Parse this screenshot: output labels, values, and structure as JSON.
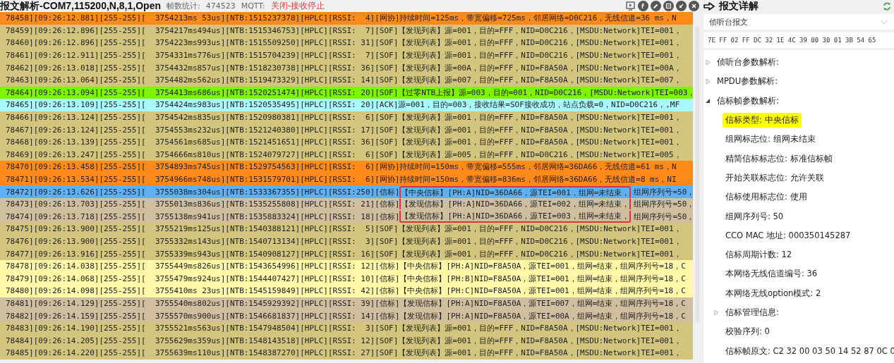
{
  "header": {
    "title": "报文解析-COM7,115200,N,8,1,Open",
    "frame_count_label": "帧数统计:",
    "frame_count": "474523",
    "mqtt_label": "MQTT:",
    "mqtt_status": "关闭-接收停止"
  },
  "log_rows": [
    {
      "color": "#ff8a1c",
      "text": "78458][09:26:12.881][255-255][  3754213ms 53us][NTB:1515237378][HPLC][RSSI:  4][网协]持续时间=125ms，带宽偏移=725ms，邻居网络=D0C216，无线信道=36 ms，N"
    },
    {
      "color": "#d2c67e",
      "text": "78459][09:26:12.896][255-255][  3754217ms494us][NTB:1515346753][HPLC][RSSI:  7][SOF]【发现列表】源=001，目的=FFF，NID=D0C216，[MSDU:Network]TEI=001，"
    },
    {
      "color": "#d2c67e",
      "text": "78460][09:26:12.896][255-255][  3754223ms993us][NTB:1515509250][HPLC][RSSI: 31][SOF]【发现列表】源=001，目的=FFF，NID=D0C216，[MSDU:Network]TEI=001，"
    },
    {
      "color": "#d2c67e",
      "text": "78461][09:26:12.911][255-255][  3754331ms776us][NTB:1515704239][HPLC][RSSI:  7][SOF]【发现列表】源=001，目的=FFF，NID=D0C216，[MSDU:Network]TEI=001，"
    },
    {
      "color": "#d2c67e",
      "text": "78462][09:26:13.018][255-255][  3754432ms857us][NTB:1518230738][HPLC][RSSI: 36][SOF]【发现列表】源=00A，目的=FFF，NID=F8A50A，[MSDU:Network]TEI=00A，"
    },
    {
      "color": "#d2c67e",
      "text": "78463][09:26:13.064][255-255][  3754482ms562us][NTB:1519473329][HPLC][RSSI: 14][SOF]【发现列表】源=007，目的=FFF，NID=F8A50A，[MSDU:Network]TEI=007，"
    },
    {
      "color": "#7ef400",
      "text": "78464][09:26:13.094][255-255][  3754413ms686us][NTB:1520251474][HPLC][RSSI: 20][SOF]【过零NTB上报】源=003，目的=001，NID=D0C216，[MSDU:Network]TEI=003，"
    },
    {
      "color": "#a8f8ff",
      "text": "78465][09:26:13.109][255-255][  3754424ms983us][NTB:1520535495][HPLC][RSSI: 20][ACK]源=001，目的=003，接收结果=SOF接收成功，站点负载=0，NID=D0C216，,MF"
    },
    {
      "color": "#d2c67e",
      "text": "78466][09:26:13.124][255-255][  3754542ms835us][NTB:1520980381][HPLC][RSSI:  6][SOF]【发现列表】源=001，目的=FFF，NID=F8A50A，[MSDU:Network]TEI=001，"
    },
    {
      "color": "#d2c67e",
      "text": "78467][09:26:13.124][255-255][  3754553ms232us][NTB:1521240380][HPLC][RSSI: 17][SOF]【发现列表】源=001，目的=FFF，NID=F8A50A，[MSDU:Network]TEI=001，"
    },
    {
      "color": "#d2c67e",
      "text": "78468][09:26:13.139][255-255][  3754561ms685us][NTB:1521451651][HPLC][RSSI: 36][SOF]【发现列表】源=001，目的=FFF，NID=F8A50A，[MSDU:Network]TEI=001，"
    },
    {
      "color": "#d2c67e",
      "text": "78469][09:26:13.247][255-255][  3754666ms810us][NTB:1524079727][HPLC][RSSI:  6][SOF]【发现列表】源=005，目的=FFF，NID=D0C216，[MSDU:Network]TEI=005，"
    },
    {
      "color": "#ff8a1c",
      "text": "78470][09:26:13.458][255-255][  3754893ms745us][NTB:1529754563][HPLC][RSSI:  6][网协]持续时间=150ms，带宽偏移=555ms，邻居网络=36DA66，无线信道=61 ms，N"
    },
    {
      "color": "#ff8a1c",
      "text": "78471][09:26:13.534][255-255][  3754966ms748us][NTB:1531579701][HPLC][RSSI:  6][网协]持续时间=150ms，带宽偏移=836ms，邻居网络=36DA66，无线信道=8 ms，NI"
    },
    {
      "color": "#5eb0f4",
      "text": "78472][09:26:13.626][255-255][  3755038ms304us][NTB:1533367355][HPLC][RSSI:250][信标]",
      "boxed_text": "【中央信标】[PH:A]NID=36DA66，源TEI=001，组网=未结束，",
      "after_text": "组网序列号=50，"
    },
    {
      "color": "#cfbf9f",
      "text": "78473][09:26:13.703][255-255][  3755013ms836us][NTB:1535255808][HPLC][RSSI: 21][信标]",
      "boxed_text": "【发现信标】[PH:A]NID=36DA66，源TEI=002，组网=未结束，",
      "after_text": "组网序列号=50，"
    },
    {
      "color": "#cfbf9f",
      "text": "78474][09:26:13.718][255-255][  3755138ms941us][NTB:1535883324][HPLC][RSSI: 18][信标]",
      "boxed_text": "【发现信标】[PH:A]NID=36DA66，源TEI=003，组网=未结束，",
      "after_text": "组网序列号=50，"
    },
    {
      "color": "#d2c67e",
      "text": "78475][09:26:13.900][255-255][  3755219ms125us][NTB:1540388121][HPLC][RSSI:  5][SOF]【发现列表】源=001，目的=FFF，NID=D0C216，[MSDU:Network]TEI=001，"
    },
    {
      "color": "#d2c67e",
      "text": "78476][09:26:13.900][255-255][  3755332ms143us][NTB:1540713134][HPLC][RSSI:  3][SOF]【发现列表】源=001，目的=FFF，NID=D0C216，[MSDU:Network]TEI=001，"
    },
    {
      "color": "#d2c67e",
      "text": "78477][09:26:13.916][255-255][  3755339ms943us][NTB:1540908127][HPLC][RSSI: 16][SOF]【发现列表】源=001，目的=FFF，NID=D0C216，[MSDU:Network]TEI=001，"
    },
    {
      "color": "#fff8a8",
      "text": "78478][09:26:14.038][255-255][  3755449ms826us][NTB:1543654996][HPLC][RSSI: 12][信标]【中央信标】[PH:A]NID=F8A50A，源TEI=001，组网=结束，组网序列号=18，C"
    },
    {
      "color": "#fff8a8",
      "text": "78479][09:26:14.068][255-255][  3755479ms924us][NTB:1544407427][HPLC][RSSI: 10][信标]【中央信标】[PH:B]NID=F8A50A，源TEI=001，组网=结束，组网序列号=18，C"
    },
    {
      "color": "#fff8a8",
      "text": "78480][09:26:14.098][255-255][  3755410ms 23us][NTB:1545159849][HPLC][RSSI: 42][信标]【中央信标】[PH:C]NID=F8A50A，源TEI=001，组网=结束，组网序列号=18，C"
    },
    {
      "color": "#cfbf9f",
      "text": "78481][09:26:14.129][255-255][  3755540ms802us][NTB:1545929392][HPLC][RSSI: 39][信标]【发现信标】[PH:A]NID=F8A50A，源TEI=007，组网=结束，组网序列号=18，C"
    },
    {
      "color": "#cfbf9f",
      "text": "78482][09:26:14.159][255-255][  3755570ms900us][NTB:1546681837][HPLC][RSSI: 14][信标]【发现信标】[PH:A]NID=F8A50A，源TEI=00A，组网=结束，组网序列号=18，C"
    },
    {
      "color": "#d2c67e",
      "text": "78483][09:26:14.190][255-255][  3755521ms563us][NTB:1547948504][HPLC][RSSI:  3][SOF]【发现列表】源=001，目的=FFF，NID=F8A50A，[MSDU:Network]TEI=001，"
    },
    {
      "color": "#d2c67e",
      "text": "78484][09:26:14.205][255-255][  3755629ms359us][NTB:1548143518][HPLC][RSSI: 12][SOF]【发现列表】源=001，目的=FFF，NID=F8A50A，[MSDU:Network]TEI=001，"
    },
    {
      "color": "#d2c67e",
      "text": "78485][09:26:14.220][255-255][  3755639ms110us][NTB:1548387270][HPLC][RSSI: 27][SOF]【发现列表】源=001，目的=FFF，NID=F8A50A，[MSDU:Network]TEI=001，"
    }
  ],
  "detail_panel": {
    "title": "报文详解",
    "frame_type": "侦听台报文",
    "hex": "7E FF 02 FF DC 32 1E 4C 39 00 30 01 3B 54 65",
    "tree": [
      {
        "label": "侦听台参数解析:",
        "expanded": false,
        "selected": false
      },
      {
        "label": "MPDU参数解析:",
        "expanded": false,
        "selected": false
      },
      {
        "label": "信标帧参数解析:",
        "expanded": true,
        "selected": false,
        "children": [
          {
            "label": "信标类型: 中央信标",
            "selected": true
          },
          {
            "label": "组网标志位: 组网未结束",
            "selected": false
          },
          {
            "label": "精简信标标志位: 标准信标帧",
            "selected": false
          },
          {
            "label": "开始关联标志位: 允许关联",
            "selected": false
          },
          {
            "label": "信标使用标志位: 使用",
            "selected": false
          },
          {
            "label": "组网序列号: 50",
            "selected": false
          },
          {
            "label": "CCO MAC 地址: 000350145287",
            "selected": false
          },
          {
            "label": "信标周期计数: 12",
            "selected": false
          },
          {
            "label": "本网络无线信道编号: 36",
            "selected": false
          },
          {
            "label": "本网络无线option模式: 2",
            "selected": false
          },
          {
            "label": "信标管理信息:",
            "expanded": false,
            "selected": false
          },
          {
            "label": "校验序列: 0",
            "selected": false
          },
          {
            "label": "信标帧原文: C2 32 00 03 50 14 52 87 0C 0",
            "selected": false
          }
        ]
      }
    ]
  }
}
